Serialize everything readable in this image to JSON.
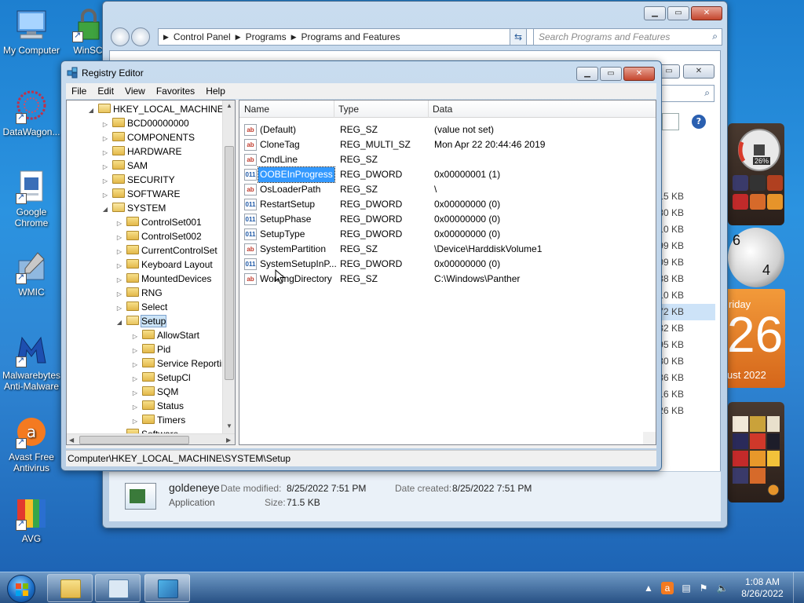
{
  "desktop": {
    "icons": [
      {
        "label": "My Computer"
      },
      {
        "label": "WinSC"
      },
      {
        "label": "DataWagon..."
      },
      {
        "label": "Google Chrome"
      },
      {
        "label": "WMIC"
      },
      {
        "label": "Malwarebytes Anti-Malware"
      },
      {
        "label": "Avast Free Antivirus"
      },
      {
        "label": "AVG"
      }
    ]
  },
  "control_panel": {
    "breadcrumb": [
      "Control Panel",
      "Programs",
      "Programs and Features"
    ],
    "search_placeholder": "Search Programs and Features",
    "sizes": [
      "15 KB",
      "780 KB",
      "10 KB",
      "99 KB",
      "09 KB",
      "38 KB",
      "10 KB",
      "72 KB",
      "32 KB",
      "795 KB",
      "580 KB",
      "36 KB",
      "16 KB",
      "26 KB"
    ],
    "details": {
      "name": "goldeneye",
      "type": "Application",
      "modified_label": "Date modified:",
      "modified_value": "8/25/2022 7:51 PM",
      "created_label": "Date created:",
      "created_value": "8/25/2022 7:51 PM",
      "size_label": "Size:",
      "size_value": "71.5 KB"
    }
  },
  "registry_editor": {
    "title": "Registry Editor",
    "menu": [
      "File",
      "Edit",
      "View",
      "Favorites",
      "Help"
    ],
    "tree": [
      {
        "label": "HKEY_LOCAL_MACHINE",
        "depth": 0
      },
      {
        "label": "BCD00000000",
        "depth": 1
      },
      {
        "label": "COMPONENTS",
        "depth": 1
      },
      {
        "label": "HARDWARE",
        "depth": 1
      },
      {
        "label": "SAM",
        "depth": 1
      },
      {
        "label": "SECURITY",
        "depth": 1
      },
      {
        "label": "SOFTWARE",
        "depth": 1
      },
      {
        "label": "SYSTEM",
        "depth": 1
      },
      {
        "label": "ControlSet001",
        "depth": 2
      },
      {
        "label": "ControlSet002",
        "depth": 2
      },
      {
        "label": "CurrentControlSet",
        "depth": 2
      },
      {
        "label": "Keyboard Layout",
        "depth": 2
      },
      {
        "label": "MountedDevices",
        "depth": 2
      },
      {
        "label": "RNG",
        "depth": 2
      },
      {
        "label": "Select",
        "depth": 2
      },
      {
        "label": "Setup",
        "depth": 2
      },
      {
        "label": "AllowStart",
        "depth": 3
      },
      {
        "label": "Pid",
        "depth": 3
      },
      {
        "label": "Service Reporting",
        "depth": 3
      },
      {
        "label": "SetupCl",
        "depth": 3
      },
      {
        "label": "SQM",
        "depth": 3
      },
      {
        "label": "Status",
        "depth": 3
      },
      {
        "label": "Timers",
        "depth": 3
      },
      {
        "label": "Software",
        "depth": 2
      }
    ],
    "columns": {
      "name": "Name",
      "type": "Type",
      "data": "Data"
    },
    "values": [
      {
        "name": "(Default)",
        "type": "REG_SZ",
        "data": "(value not set)",
        "icon": "ab"
      },
      {
        "name": "CloneTag",
        "type": "REG_MULTI_SZ",
        "data": "Mon Apr 22 20:44:46 2019",
        "icon": "ab"
      },
      {
        "name": "CmdLine",
        "type": "REG_SZ",
        "data": "",
        "icon": "ab"
      },
      {
        "name": "OOBEInProgress",
        "type": "REG_DWORD",
        "data": "0x00000001 (1)",
        "icon": "bin"
      },
      {
        "name": "OsLoaderPath",
        "type": "REG_SZ",
        "data": "\\",
        "icon": "ab"
      },
      {
        "name": "RestartSetup",
        "type": "REG_DWORD",
        "data": "0x00000000 (0)",
        "icon": "bin"
      },
      {
        "name": "SetupPhase",
        "type": "REG_DWORD",
        "data": "0x00000000 (0)",
        "icon": "bin"
      },
      {
        "name": "SetupType",
        "type": "REG_DWORD",
        "data": "0x00000000 (0)",
        "icon": "bin"
      },
      {
        "name": "SystemPartition",
        "type": "REG_SZ",
        "data": "\\Device\\HarddiskVolume1",
        "icon": "ab"
      },
      {
        "name": "SystemSetupInP...",
        "type": "REG_DWORD",
        "data": "0x00000000 (0)",
        "icon": "bin"
      },
      {
        "name": "WorkingDirectory",
        "type": "REG_SZ",
        "data": "C:\\Windows\\Panther",
        "icon": "ab"
      }
    ],
    "status": "Computer\\HKEY_LOCAL_MACHINE\\SYSTEM\\Setup"
  },
  "gadgets": {
    "cpu_percent": "26%",
    "calendar_day": "riday",
    "calendar_date": "26",
    "calendar_month": "ust 2022",
    "clock_numbers": [
      "6",
      "4"
    ]
  },
  "taskbar": {
    "time": "1:08 AM",
    "date": "8/26/2022"
  }
}
